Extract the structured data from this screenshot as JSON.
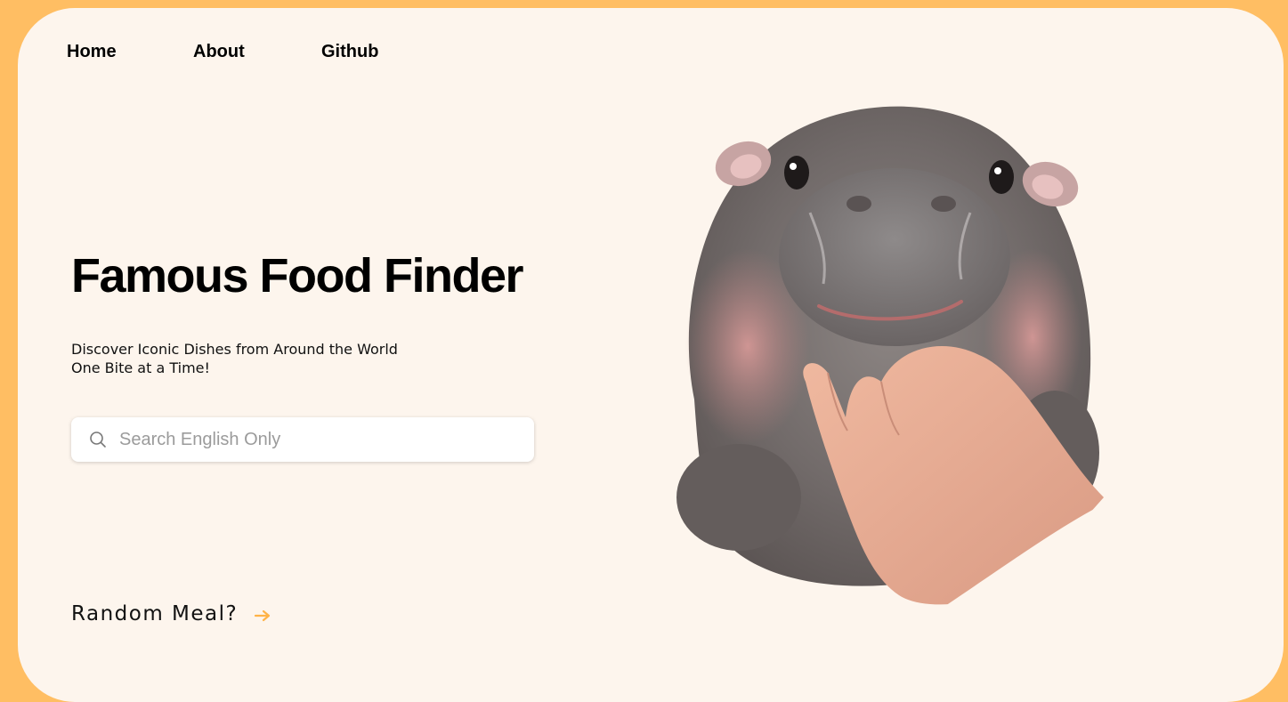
{
  "nav": {
    "home": "Home",
    "about": "About",
    "github": "Github"
  },
  "hero": {
    "title": "Famous Food Finder",
    "subtitle_line1": "Discover Iconic Dishes from Around the World",
    "subtitle_line2": "One Bite at a Time!"
  },
  "search": {
    "placeholder": "Search English Only",
    "value": ""
  },
  "random": {
    "label": "Random Meal?"
  },
  "colors": {
    "background": "#ffbe63",
    "card": "#fdf5ed",
    "accent_arrow": "#ffb347"
  },
  "icons": {
    "search": "search-icon",
    "arrow": "arrow-right-icon"
  }
}
